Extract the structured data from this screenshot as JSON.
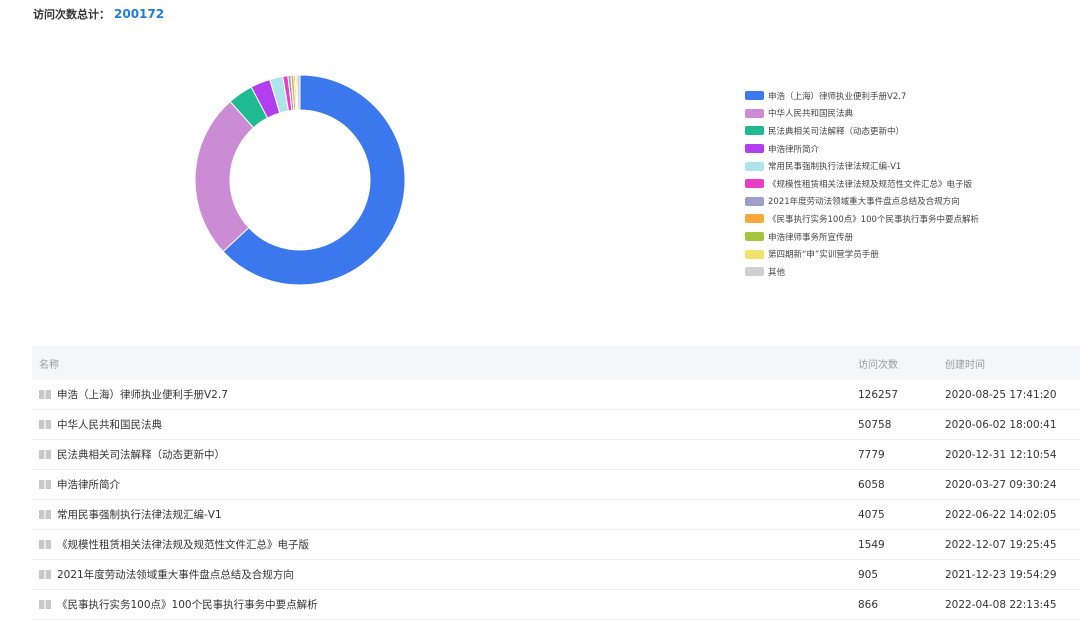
{
  "header": {
    "total_label": "访问次数总计：",
    "total_value": "200172"
  },
  "chart_data": {
    "type": "pie",
    "categories": [
      "申浩（上海）律师执业便利手册V2.7",
      "中华人民共和国民法典",
      "民法典相关司法解释（动态更新中）",
      "申浩律所简介",
      "常用民事强制执行法律法规汇编-V1",
      "《规模性租赁相关法律法规及规范性文件汇总》电子版",
      "2021年度劳动法领域重大事件盘点总结及合规方向",
      "《民事执行实务100点》100个民事执行事务中要点解析",
      "申浩律师事务所宣传册",
      "第四期新“申”实训营学员手册",
      "其他"
    ],
    "values": [
      126257,
      50758,
      7779,
      6058,
      4075,
      1549,
      905,
      866,
      500,
      450,
      975
    ],
    "colors": [
      "#3b78ee",
      "#cc8bd5",
      "#1fba92",
      "#b23ef0",
      "#aee3ea",
      "#e83ec6",
      "#9d9ec9",
      "#f5a93b",
      "#a4c63f",
      "#f2e26b",
      "#d0d0d0"
    ],
    "legend": "right"
  },
  "table": {
    "headers": {
      "name": "名称",
      "count": "访问次数",
      "date": "创建时间"
    },
    "icon": "book-icon",
    "rows": [
      {
        "name": "申浩（上海）律师执业便利手册V2.7",
        "count": "126257",
        "date": "2020-08-25 17:41:20"
      },
      {
        "name": "中华人民共和国民法典",
        "count": "50758",
        "date": "2020-06-02 18:00:41"
      },
      {
        "name": "民法典相关司法解释（动态更新中）",
        "count": "7779",
        "date": "2020-12-31 12:10:54"
      },
      {
        "name": "申浩律所简介",
        "count": "6058",
        "date": "2020-03-27 09:30:24"
      },
      {
        "name": "常用民事强制执行法律法规汇编-V1",
        "count": "4075",
        "date": "2022-06-22 14:02:05"
      },
      {
        "name": "《规模性租赁相关法律法规及规范性文件汇总》电子版",
        "count": "1549",
        "date": "2022-12-07 19:25:45"
      },
      {
        "name": "2021年度劳动法领域重大事件盘点总结及合规方向",
        "count": "905",
        "date": "2021-12-23 19:54:29"
      },
      {
        "name": "《民事执行实务100点》100个民事执行事务中要点解析",
        "count": "866",
        "date": "2022-04-08 22:13:45"
      }
    ]
  }
}
